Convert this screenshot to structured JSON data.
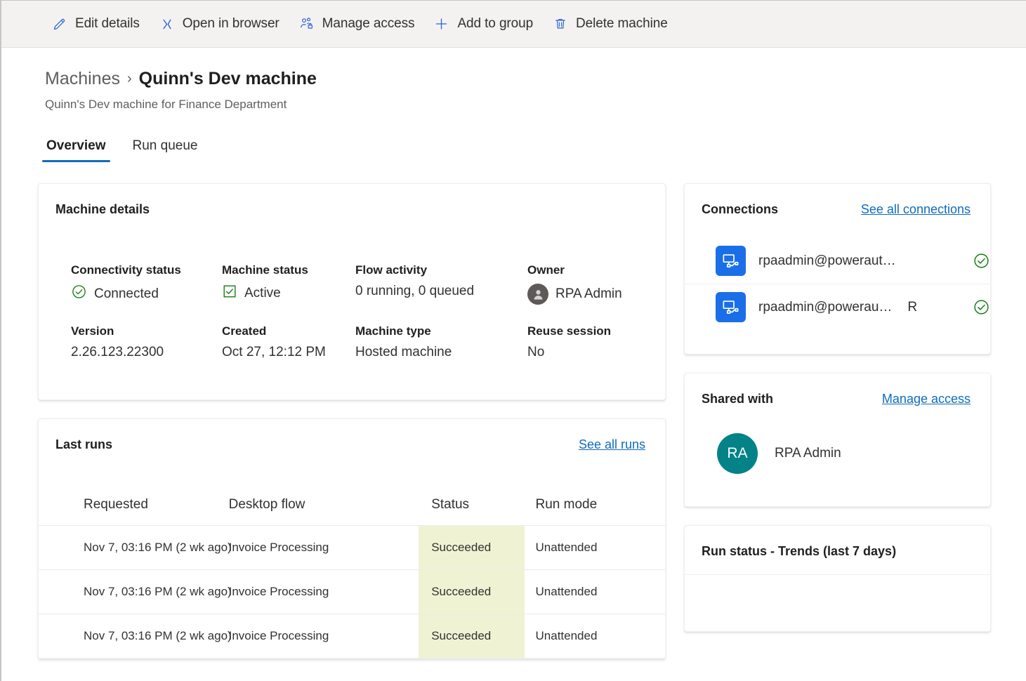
{
  "commandbar": {
    "buttons": [
      {
        "label": "Edit details",
        "icon": "pencil-icon"
      },
      {
        "label": "Open in browser",
        "icon": "open-in-browser-icon"
      },
      {
        "label": "Manage access",
        "icon": "manage-access-icon"
      },
      {
        "label": "Add to group",
        "icon": "plus-icon"
      },
      {
        "label": "Delete machine",
        "icon": "trash-icon"
      }
    ]
  },
  "header": {
    "breadcrumb_parent": "Machines",
    "breadcrumb_separator": "›",
    "breadcrumb_current": "Quinn's Dev machine",
    "subtitle": "Quinn's Dev machine for Finance Department"
  },
  "tabs": [
    {
      "label": "Overview",
      "active": true
    },
    {
      "label": "Run queue",
      "active": false
    }
  ],
  "machine_details": {
    "title": "Machine details",
    "fields": [
      {
        "label": "Connectivity status",
        "value": "Connected",
        "icon": "circle-check-icon"
      },
      {
        "label": "Machine status",
        "value": "Active",
        "icon": "checkbox-checked-icon"
      },
      {
        "label": "Flow activity",
        "value": "0 running, 0 queued",
        "icon": ""
      },
      {
        "label": "Owner",
        "value": "RPA Admin",
        "icon": "person-avatar-icon"
      },
      {
        "label": "Version",
        "value": "2.26.123.22300",
        "icon": ""
      },
      {
        "label": "Created",
        "value": "Oct 27, 12:12 PM",
        "icon": ""
      },
      {
        "label": "Machine type",
        "value": "Hosted machine",
        "icon": ""
      },
      {
        "label": "Reuse session",
        "value": "No",
        "icon": ""
      }
    ]
  },
  "last_runs": {
    "title": "Last runs",
    "link": "See all runs",
    "columns": [
      "Requested",
      "Desktop flow",
      "Status",
      "Run mode"
    ],
    "rows": [
      {
        "requested": "Nov 7, 03:16 PM (2 wk ago)",
        "flow": "Invoice Processing",
        "status": "Succeeded",
        "mode": "Unattended"
      },
      {
        "requested": "Nov 7, 03:16 PM (2 wk ago)",
        "flow": "Invoice Processing",
        "status": "Succeeded",
        "mode": "Unattended"
      },
      {
        "requested": "Nov 7, 03:16 PM (2 wk ago)",
        "flow": "Invoice Processing",
        "status": "Succeeded",
        "mode": "Unattended"
      }
    ]
  },
  "connections": {
    "title": "Connections",
    "link": "See all connections",
    "items": [
      {
        "name": "rpaadmin@poweraut…",
        "extra": "",
        "status_icon": "circle-check-icon"
      },
      {
        "name": "rpaadmin@powerau…",
        "extra": "R",
        "status_icon": "circle-check-icon"
      }
    ]
  },
  "shared_with": {
    "title": "Shared with",
    "link": "Manage access",
    "people": [
      {
        "initials": "RA",
        "name": "RPA Admin"
      }
    ]
  },
  "run_status_trends": {
    "title": "Run status - Trends (last 7 days)"
  },
  "colors": {
    "accent": "#0f6cbd",
    "link": "#0f6cbd",
    "success_green": "#107c10",
    "status_cell_bg": "#eff3d3",
    "connection_blue": "#1a6fe8",
    "avatar_teal": "#038387",
    "commandbar_bg": "#f3f2f1"
  }
}
